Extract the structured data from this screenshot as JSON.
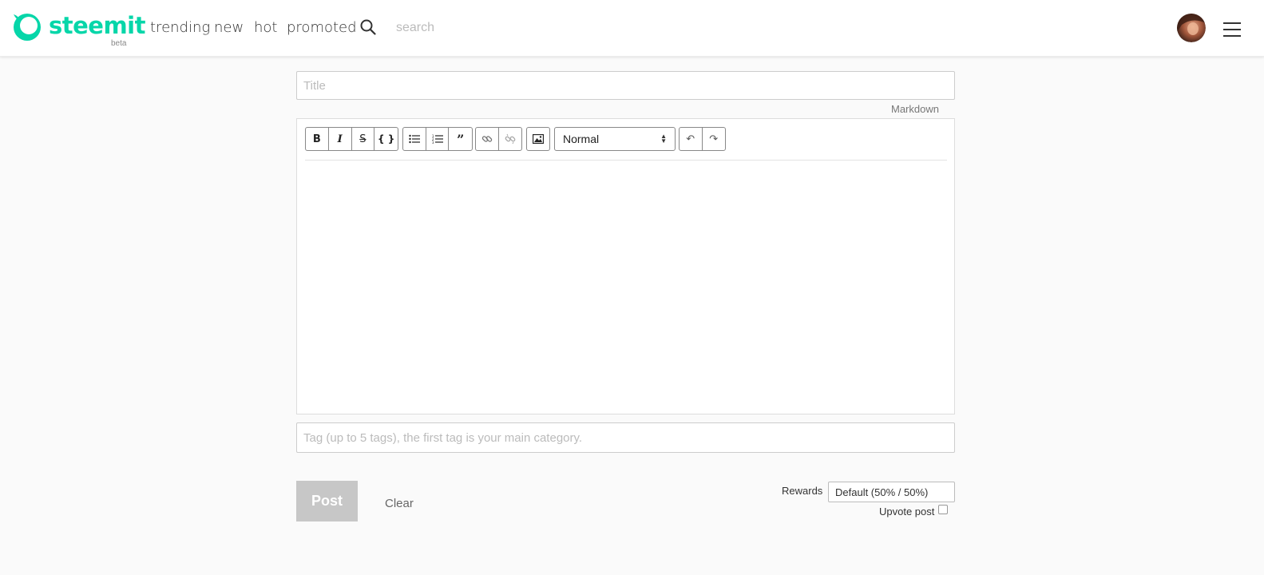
{
  "header": {
    "brand": "steemit",
    "beta": "beta",
    "nav": [
      "trending",
      "new",
      "hot",
      "promoted"
    ],
    "search_placeholder": "search",
    "brand_color": "#06d6a9"
  },
  "editor": {
    "title_placeholder": "Title",
    "markdown_link": "Markdown",
    "format_value": "Normal",
    "toolbar_icons": [
      "bold-icon",
      "italic-icon",
      "strikethrough-icon",
      "code-block-icon",
      "bullet-list-icon",
      "ordered-list-icon",
      "blockquote-icon",
      "link-icon",
      "unlink-icon",
      "image-icon",
      "undo-icon",
      "redo-icon"
    ]
  },
  "tags": {
    "placeholder": "Tag (up to 5 tags), the first tag is your main category."
  },
  "actions": {
    "post_label": "Post",
    "clear_label": "Clear",
    "rewards_label": "Rewards",
    "rewards_value": "Default (50% / 50%)",
    "upvote_label": "Upvote post",
    "upvote_checked": false
  }
}
